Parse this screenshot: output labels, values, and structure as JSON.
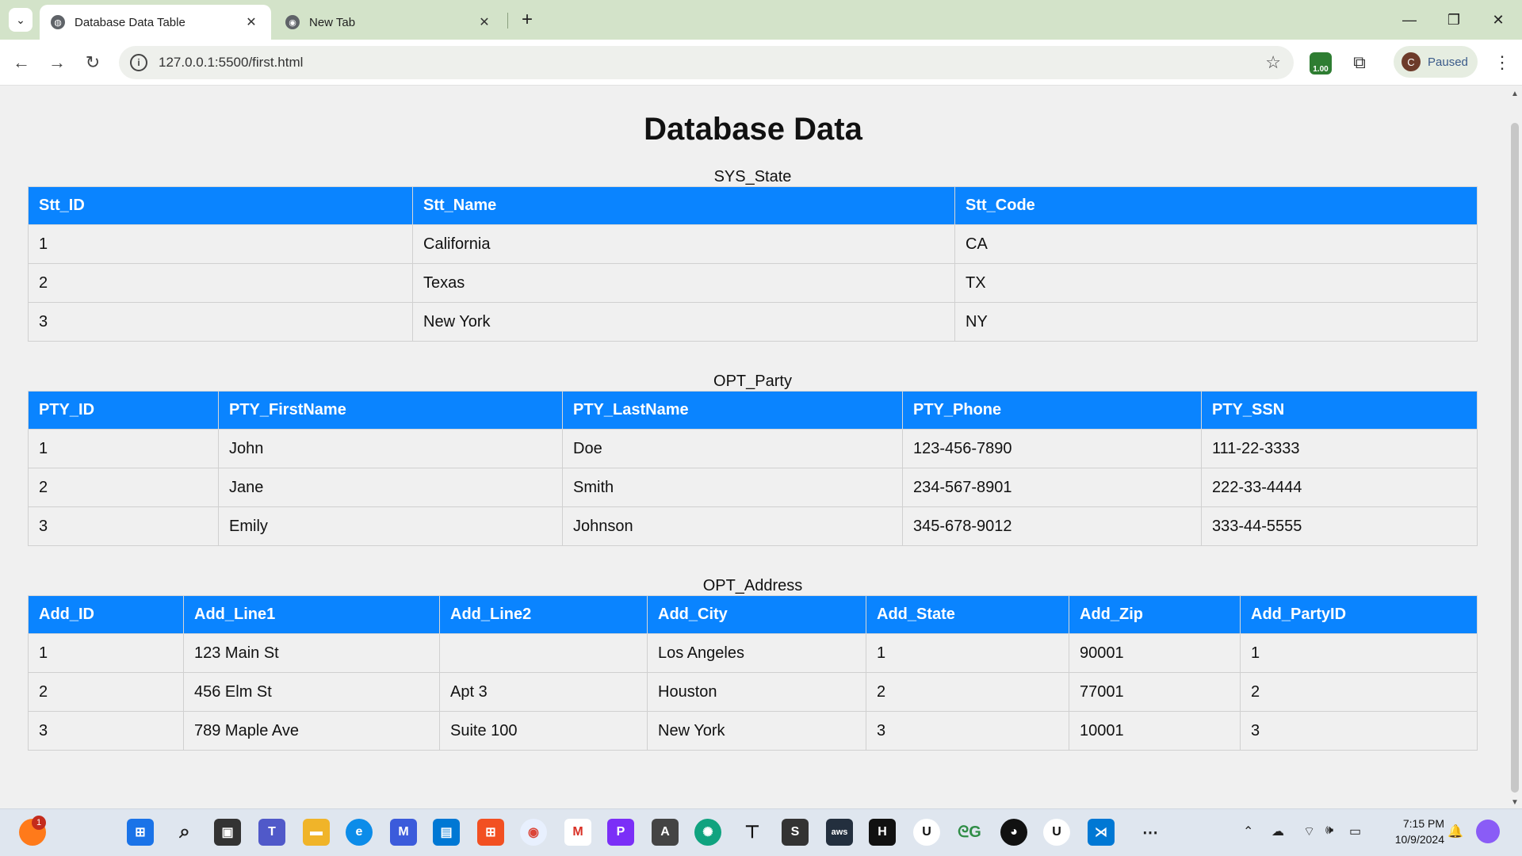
{
  "browser": {
    "tabs": [
      {
        "title": "Database Data Table",
        "active": true
      },
      {
        "title": "New Tab",
        "active": false
      }
    ],
    "url": "127.0.0.1:5500/first.html",
    "extension_badge": "1.00",
    "profile_initial": "C",
    "profile_status": "Paused"
  },
  "page": {
    "title": "Database Data",
    "tables": [
      {
        "caption": "SYS_State",
        "columns": [
          "Stt_ID",
          "Stt_Name",
          "Stt_Code"
        ],
        "rows": [
          [
            "1",
            "California",
            "CA"
          ],
          [
            "2",
            "Texas",
            "TX"
          ],
          [
            "3",
            "New York",
            "NY"
          ]
        ]
      },
      {
        "caption": "OPT_Party",
        "columns": [
          "PTY_ID",
          "PTY_FirstName",
          "PTY_LastName",
          "PTY_Phone",
          "PTY_SSN"
        ],
        "rows": [
          [
            "1",
            "John",
            "Doe",
            "123-456-7890",
            "111-22-3333"
          ],
          [
            "2",
            "Jane",
            "Smith",
            "234-567-8901",
            "222-33-4444"
          ],
          [
            "3",
            "Emily",
            "Johnson",
            "345-678-9012",
            "333-44-5555"
          ]
        ]
      },
      {
        "caption": "OPT_Address",
        "columns": [
          "Add_ID",
          "Add_Line1",
          "Add_Line2",
          "Add_City",
          "Add_State",
          "Add_Zip",
          "Add_PartyID"
        ],
        "rows": [
          [
            "1",
            "123 Main St",
            "",
            "Los Angeles",
            "1",
            "90001",
            "1"
          ],
          [
            "2",
            "456 Elm St",
            "Apt 3",
            "Houston",
            "2",
            "77001",
            "2"
          ],
          [
            "3",
            "789 Maple Ave",
            "Suite 100",
            "New York",
            "3",
            "10001",
            "3"
          ]
        ]
      }
    ]
  },
  "taskbar": {
    "firefox_badge": "1",
    "time": "7:15 PM",
    "date": "10/9/2024"
  },
  "colors": {
    "header_bg": "#0a84ff",
    "page_bg": "#f0f0f0",
    "tabstrip_bg": "#d3e3c9"
  }
}
